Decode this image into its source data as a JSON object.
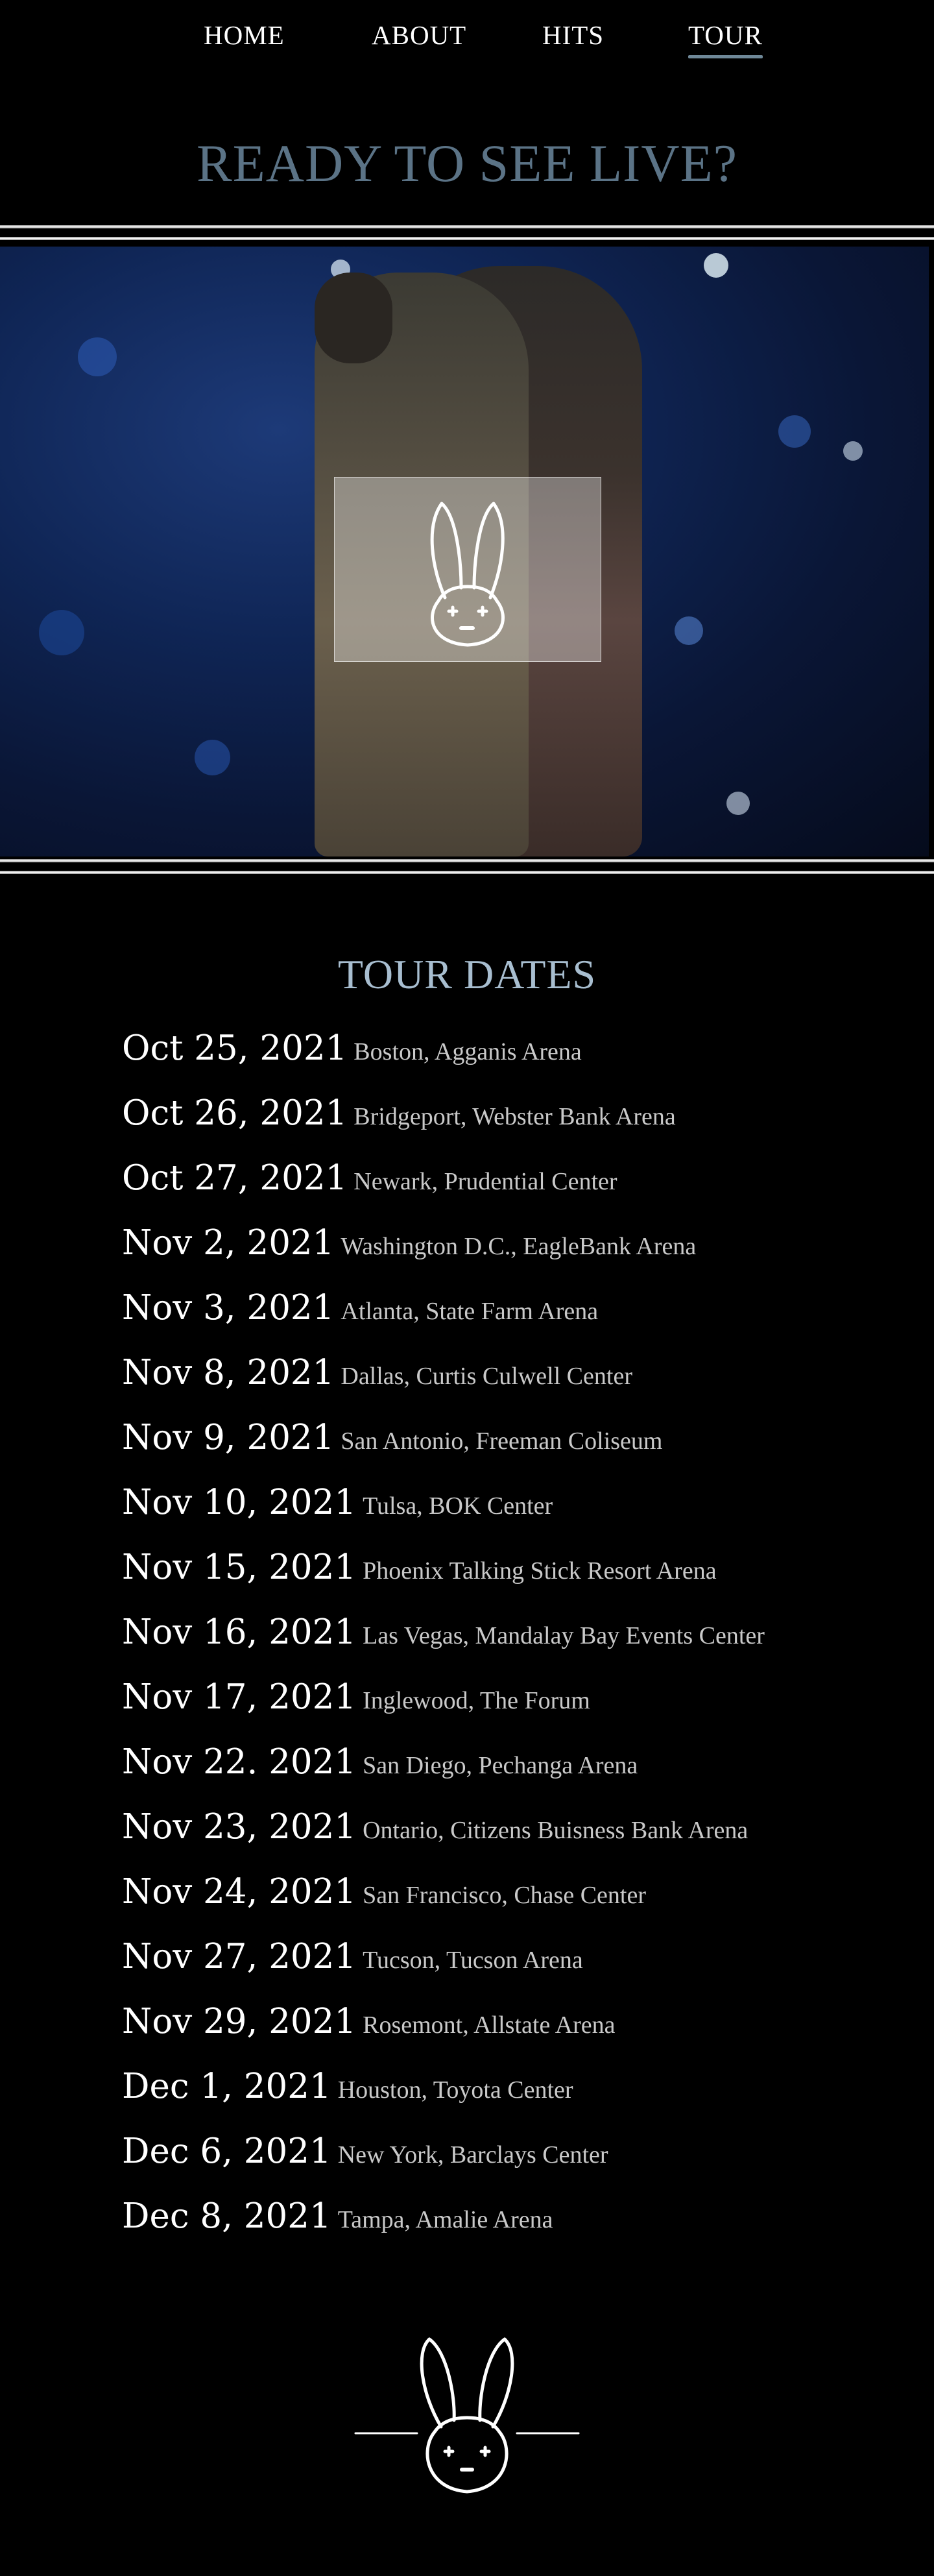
{
  "nav": {
    "items": [
      {
        "label": "HOME"
      },
      {
        "label": "ABOUT"
      },
      {
        "label": "HITS"
      },
      {
        "label": "TOUR"
      }
    ],
    "active": "TOUR"
  },
  "hero": {
    "title": "READY TO SEE LIVE?"
  },
  "tour": {
    "title": "TOUR DATES",
    "dates": [
      {
        "date": "Oct 25, 2021",
        "venue": "Boston, Agganis Arena"
      },
      {
        "date": "Oct 26, 2021",
        "venue": "Bridgeport, Webster Bank Arena"
      },
      {
        "date": "Oct 27, 2021",
        "venue": "Newark, Prudential Center"
      },
      {
        "date": "Nov 2, 2021",
        "venue": "Washington D.C., EagleBank Arena"
      },
      {
        "date": "Nov 3, 2021",
        "venue": "Atlanta, State Farm Arena"
      },
      {
        "date": "Nov 8, 2021",
        "venue": "Dallas, Curtis Culwell Center"
      },
      {
        "date": "Nov 9, 2021",
        "venue": "San Antonio, Freeman Coliseum"
      },
      {
        "date": "Nov 10, 2021",
        "venue": "Tulsa, BOK Center"
      },
      {
        "date": "Nov 15, 2021",
        "venue": "Phoenix Talking Stick Resort Arena"
      },
      {
        "date": "Nov 16, 2021",
        "venue": "Las Vegas, Mandalay Bay Events Center"
      },
      {
        "date": "Nov 17, 2021",
        "venue": "Inglewood, The Forum"
      },
      {
        "date": "Nov 22. 2021",
        "venue": "San Diego, Pechanga Arena"
      },
      {
        "date": "Nov 23, 2021",
        "venue": "Ontario, Citizens Buisness Bank Arena"
      },
      {
        "date": "Nov 24, 2021",
        "venue": "San Francisco, Chase Center"
      },
      {
        "date": "Nov 27, 2021",
        "venue": "Tucson, Tucson Arena"
      },
      {
        "date": "Nov 29, 2021",
        "venue": "Rosemont, Allstate Arena"
      },
      {
        "date": "Dec 1, 2021",
        "venue": "Houston, Toyota Center"
      },
      {
        "date": "Dec 6, 2021",
        "venue": "New York, Barclays Center"
      },
      {
        "date": "Dec 8, 2021",
        "venue": "Tampa, Amalie Arena"
      }
    ]
  },
  "icons": {
    "hero_logo": "bunny-logo-icon",
    "footer_logo": "bunny-logo-icon"
  },
  "colors": {
    "background": "#000000",
    "hero_title": "#5b7386",
    "tour_title": "#a8bed0",
    "nav_underline": "#6f8898"
  }
}
